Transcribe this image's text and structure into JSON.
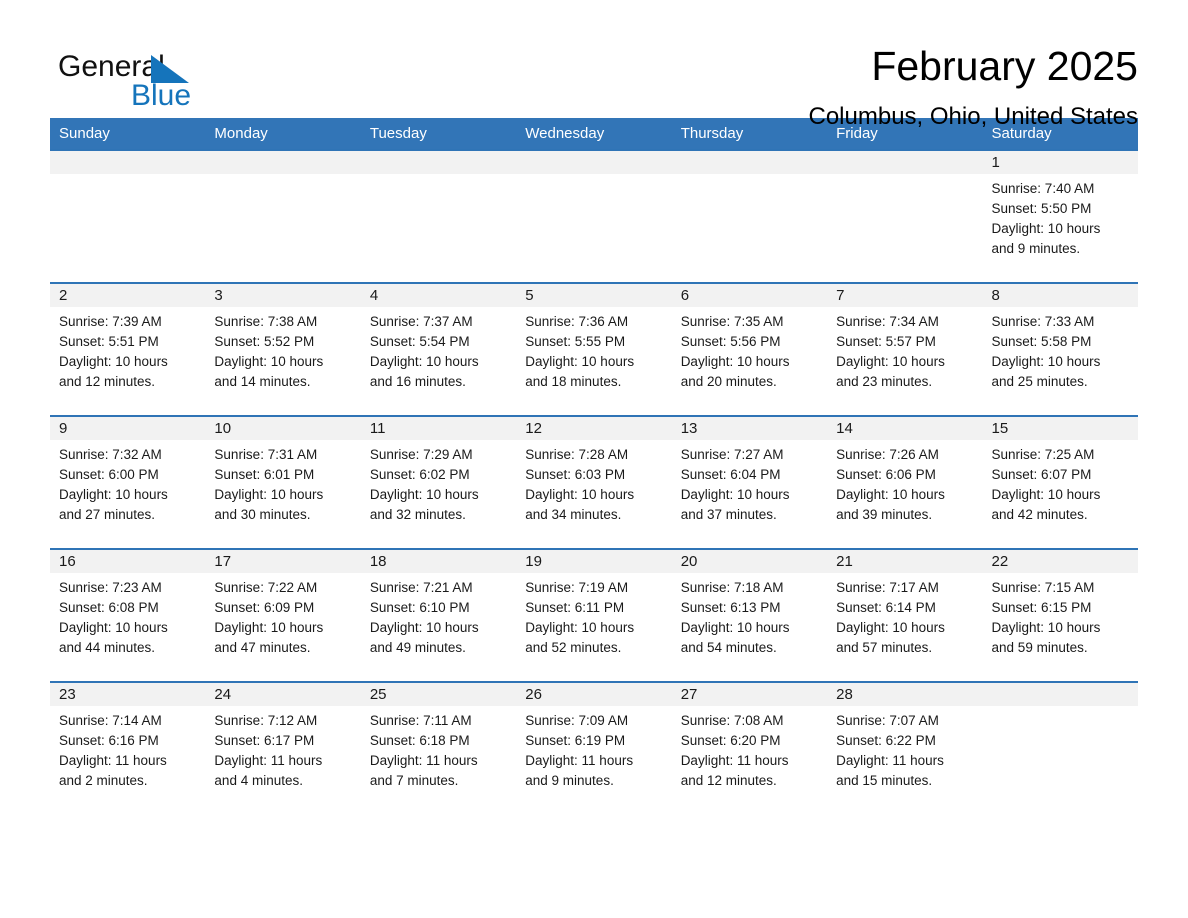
{
  "brand": {
    "name_part1": "General",
    "name_part2": "Blue",
    "triangle_color": "#1574bb"
  },
  "header": {
    "title": "February 2025",
    "subtitle": "Columbus, Ohio, United States"
  },
  "theme": {
    "header_row_bg": "#3275b7",
    "row_divider": "#2f74b6",
    "daynum_band_bg": "#f2f2f2",
    "text": "#1a1a1a"
  },
  "weekday_headers": [
    "Sunday",
    "Monday",
    "Tuesday",
    "Wednesday",
    "Thursday",
    "Friday",
    "Saturday"
  ],
  "weeks": [
    [
      {
        "day": "",
        "sunrise": "",
        "sunset": "",
        "daylight1": "",
        "daylight2": ""
      },
      {
        "day": "",
        "sunrise": "",
        "sunset": "",
        "daylight1": "",
        "daylight2": ""
      },
      {
        "day": "",
        "sunrise": "",
        "sunset": "",
        "daylight1": "",
        "daylight2": ""
      },
      {
        "day": "",
        "sunrise": "",
        "sunset": "",
        "daylight1": "",
        "daylight2": ""
      },
      {
        "day": "",
        "sunrise": "",
        "sunset": "",
        "daylight1": "",
        "daylight2": ""
      },
      {
        "day": "",
        "sunrise": "",
        "sunset": "",
        "daylight1": "",
        "daylight2": ""
      },
      {
        "day": "1",
        "sunrise": "Sunrise: 7:40 AM",
        "sunset": "Sunset: 5:50 PM",
        "daylight1": "Daylight: 10 hours",
        "daylight2": "and 9 minutes."
      }
    ],
    [
      {
        "day": "2",
        "sunrise": "Sunrise: 7:39 AM",
        "sunset": "Sunset: 5:51 PM",
        "daylight1": "Daylight: 10 hours",
        "daylight2": "and 12 minutes."
      },
      {
        "day": "3",
        "sunrise": "Sunrise: 7:38 AM",
        "sunset": "Sunset: 5:52 PM",
        "daylight1": "Daylight: 10 hours",
        "daylight2": "and 14 minutes."
      },
      {
        "day": "4",
        "sunrise": "Sunrise: 7:37 AM",
        "sunset": "Sunset: 5:54 PM",
        "daylight1": "Daylight: 10 hours",
        "daylight2": "and 16 minutes."
      },
      {
        "day": "5",
        "sunrise": "Sunrise: 7:36 AM",
        "sunset": "Sunset: 5:55 PM",
        "daylight1": "Daylight: 10 hours",
        "daylight2": "and 18 minutes."
      },
      {
        "day": "6",
        "sunrise": "Sunrise: 7:35 AM",
        "sunset": "Sunset: 5:56 PM",
        "daylight1": "Daylight: 10 hours",
        "daylight2": "and 20 minutes."
      },
      {
        "day": "7",
        "sunrise": "Sunrise: 7:34 AM",
        "sunset": "Sunset: 5:57 PM",
        "daylight1": "Daylight: 10 hours",
        "daylight2": "and 23 minutes."
      },
      {
        "day": "8",
        "sunrise": "Sunrise: 7:33 AM",
        "sunset": "Sunset: 5:58 PM",
        "daylight1": "Daylight: 10 hours",
        "daylight2": "and 25 minutes."
      }
    ],
    [
      {
        "day": "9",
        "sunrise": "Sunrise: 7:32 AM",
        "sunset": "Sunset: 6:00 PM",
        "daylight1": "Daylight: 10 hours",
        "daylight2": "and 27 minutes."
      },
      {
        "day": "10",
        "sunrise": "Sunrise: 7:31 AM",
        "sunset": "Sunset: 6:01 PM",
        "daylight1": "Daylight: 10 hours",
        "daylight2": "and 30 minutes."
      },
      {
        "day": "11",
        "sunrise": "Sunrise: 7:29 AM",
        "sunset": "Sunset: 6:02 PM",
        "daylight1": "Daylight: 10 hours",
        "daylight2": "and 32 minutes."
      },
      {
        "day": "12",
        "sunrise": "Sunrise: 7:28 AM",
        "sunset": "Sunset: 6:03 PM",
        "daylight1": "Daylight: 10 hours",
        "daylight2": "and 34 minutes."
      },
      {
        "day": "13",
        "sunrise": "Sunrise: 7:27 AM",
        "sunset": "Sunset: 6:04 PM",
        "daylight1": "Daylight: 10 hours",
        "daylight2": "and 37 minutes."
      },
      {
        "day": "14",
        "sunrise": "Sunrise: 7:26 AM",
        "sunset": "Sunset: 6:06 PM",
        "daylight1": "Daylight: 10 hours",
        "daylight2": "and 39 minutes."
      },
      {
        "day": "15",
        "sunrise": "Sunrise: 7:25 AM",
        "sunset": "Sunset: 6:07 PM",
        "daylight1": "Daylight: 10 hours",
        "daylight2": "and 42 minutes."
      }
    ],
    [
      {
        "day": "16",
        "sunrise": "Sunrise: 7:23 AM",
        "sunset": "Sunset: 6:08 PM",
        "daylight1": "Daylight: 10 hours",
        "daylight2": "and 44 minutes."
      },
      {
        "day": "17",
        "sunrise": "Sunrise: 7:22 AM",
        "sunset": "Sunset: 6:09 PM",
        "daylight1": "Daylight: 10 hours",
        "daylight2": "and 47 minutes."
      },
      {
        "day": "18",
        "sunrise": "Sunrise: 7:21 AM",
        "sunset": "Sunset: 6:10 PM",
        "daylight1": "Daylight: 10 hours",
        "daylight2": "and 49 minutes."
      },
      {
        "day": "19",
        "sunrise": "Sunrise: 7:19 AM",
        "sunset": "Sunset: 6:11 PM",
        "daylight1": "Daylight: 10 hours",
        "daylight2": "and 52 minutes."
      },
      {
        "day": "20",
        "sunrise": "Sunrise: 7:18 AM",
        "sunset": "Sunset: 6:13 PM",
        "daylight1": "Daylight: 10 hours",
        "daylight2": "and 54 minutes."
      },
      {
        "day": "21",
        "sunrise": "Sunrise: 7:17 AM",
        "sunset": "Sunset: 6:14 PM",
        "daylight1": "Daylight: 10 hours",
        "daylight2": "and 57 minutes."
      },
      {
        "day": "22",
        "sunrise": "Sunrise: 7:15 AM",
        "sunset": "Sunset: 6:15 PM",
        "daylight1": "Daylight: 10 hours",
        "daylight2": "and 59 minutes."
      }
    ],
    [
      {
        "day": "23",
        "sunrise": "Sunrise: 7:14 AM",
        "sunset": "Sunset: 6:16 PM",
        "daylight1": "Daylight: 11 hours",
        "daylight2": "and 2 minutes."
      },
      {
        "day": "24",
        "sunrise": "Sunrise: 7:12 AM",
        "sunset": "Sunset: 6:17 PM",
        "daylight1": "Daylight: 11 hours",
        "daylight2": "and 4 minutes."
      },
      {
        "day": "25",
        "sunrise": "Sunrise: 7:11 AM",
        "sunset": "Sunset: 6:18 PM",
        "daylight1": "Daylight: 11 hours",
        "daylight2": "and 7 minutes."
      },
      {
        "day": "26",
        "sunrise": "Sunrise: 7:09 AM",
        "sunset": "Sunset: 6:19 PM",
        "daylight1": "Daylight: 11 hours",
        "daylight2": "and 9 minutes."
      },
      {
        "day": "27",
        "sunrise": "Sunrise: 7:08 AM",
        "sunset": "Sunset: 6:20 PM",
        "daylight1": "Daylight: 11 hours",
        "daylight2": "and 12 minutes."
      },
      {
        "day": "28",
        "sunrise": "Sunrise: 7:07 AM",
        "sunset": "Sunset: 6:22 PM",
        "daylight1": "Daylight: 11 hours",
        "daylight2": "and 15 minutes."
      },
      {
        "day": "",
        "sunrise": "",
        "sunset": "",
        "daylight1": "",
        "daylight2": ""
      }
    ]
  ]
}
